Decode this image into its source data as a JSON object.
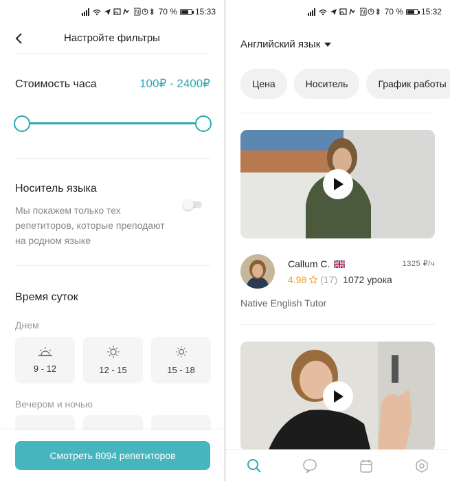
{
  "status_left": {
    "time": "15:33",
    "battery": "70 %",
    "battery_level": 0.7
  },
  "status_right": {
    "time": "15:32",
    "battery": "70 %",
    "battery_level": 0.7
  },
  "filters": {
    "title": "Настройте фильтры",
    "price_label": "Стоимость часа",
    "price_range": "100₽ - 2400₽",
    "native_title": "Носитель языка",
    "native_desc": "Мы покажем только тех репетиторов, которые преподают на родном языке",
    "native_enabled": false,
    "time_title": "Время суток",
    "day_label": "Днем",
    "day_slots": [
      "9 - 12",
      "12 - 15",
      "15 - 18"
    ],
    "evening_label": "Вечером и ночью",
    "cta_label": "Смотреть 8094 репетиторов"
  },
  "catalog": {
    "language": "Английский язык",
    "chips": [
      "Цена",
      "Носитель",
      "График работы"
    ],
    "tutor": {
      "name": "Callum C.",
      "price": "1325 ₽/ч",
      "rating": "4.98",
      "reviews": "(17)",
      "lessons": "1072 урока",
      "tagline": "Native English Tutor"
    }
  },
  "colors": {
    "accent": "#2ba8b0",
    "button": "#47b5bd",
    "star": "#f0a030"
  }
}
